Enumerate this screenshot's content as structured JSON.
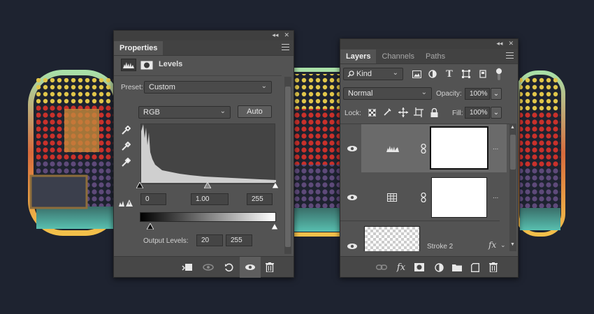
{
  "properties_panel": {
    "tab_label": "Properties",
    "collapse_glyph": "◂◂",
    "close_glyph": "✕",
    "adjustment_title": "Levels",
    "preset_label": "Preset:",
    "preset_value": "Custom",
    "channel_value": "RGB",
    "auto_button": "Auto",
    "input_black": "0",
    "input_gamma": "1.00",
    "input_white": "255",
    "output_label": "Output Levels:",
    "output_black": "20",
    "output_white": "255",
    "icons": {
      "levels": "levels-icon",
      "mask": "mask-icon",
      "eyedropper_black": "eyedropper-black-icon",
      "eyedropper_gray": "eyedropper-gray-icon",
      "eyedropper_white": "eyedropper-white-icon",
      "warning": "clipping-warning-icon",
      "clip": "clip-to-layer-icon",
      "view_previous": "view-previous-icon",
      "reset": "reset-icon",
      "visibility": "visibility-icon",
      "trash": "trash-icon"
    }
  },
  "layers_panel": {
    "tabs": [
      {
        "label": "Layers",
        "active": true
      },
      {
        "label": "Channels",
        "active": false
      },
      {
        "label": "Paths",
        "active": false
      }
    ],
    "collapse_glyph": "◂◂",
    "close_glyph": "✕",
    "filter_value": "Kind",
    "blend_mode": "Normal",
    "opacity_label": "Opacity:",
    "opacity_value": "100%",
    "lock_label": "Lock:",
    "fill_label": "Fill:",
    "fill_value": "100%",
    "layers": [
      {
        "type": "levels-adjustment",
        "name": "",
        "selected": true
      },
      {
        "type": "grid-adjustment",
        "name": "",
        "selected": false
      },
      {
        "type": "pixel",
        "name": "Stroke 2",
        "selected": false,
        "fx": "fx"
      }
    ],
    "more_glyph": "...",
    "footer_icons": [
      "link-layers-icon",
      "fx-icon",
      "add-mask-icon",
      "adjustment-layer-icon",
      "new-group-icon",
      "new-layer-icon",
      "trash-icon"
    ]
  },
  "colors": {
    "panel": "#535353",
    "panel_dark": "#424242",
    "selected_row": "#6a6a6a",
    "background": "#1e2330"
  }
}
